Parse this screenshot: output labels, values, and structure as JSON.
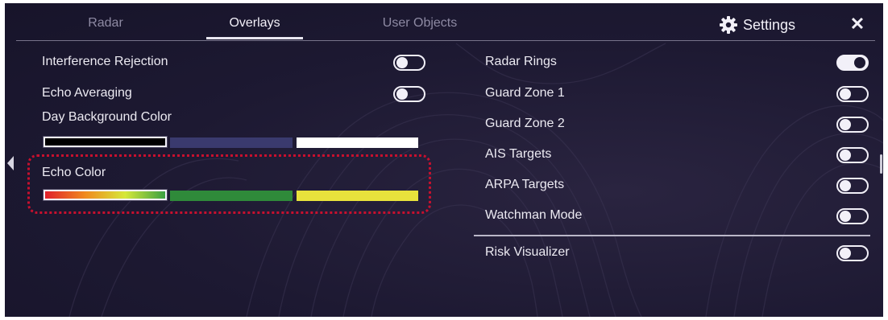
{
  "tabs": [
    {
      "label": "Radar",
      "active": false
    },
    {
      "label": "Overlays",
      "active": true
    },
    {
      "label": "User Objects",
      "active": false
    }
  ],
  "header": {
    "settings_label": "Settings",
    "close_glyph": "✕",
    "settings_icon": "gear-icon"
  },
  "left": {
    "interference_rejection": {
      "label": "Interference Rejection",
      "on": false
    },
    "echo_averaging": {
      "label": "Echo Averaging",
      "on": false
    },
    "day_background": {
      "label": "Day Background Color",
      "swatches": [
        "#000000",
        "#3a3a6e",
        "#ffffff"
      ],
      "selected": 0
    },
    "echo_color": {
      "label": "Echo Color",
      "swatches": [
        "multicolor",
        "#2f8a3a",
        "#e8e23c"
      ],
      "selected": 0
    }
  },
  "right": [
    {
      "label": "Radar Rings",
      "on": true
    },
    {
      "label": "Guard Zone 1",
      "on": false
    },
    {
      "label": "Guard Zone 2",
      "on": false
    },
    {
      "label": "AIS Targets",
      "on": false
    },
    {
      "label": "ARPA Targets",
      "on": false
    },
    {
      "label": "Watchman Mode",
      "on": false
    },
    {
      "label": "Risk Visualizer",
      "on": false
    }
  ],
  "colors": {
    "background": "#1d1932",
    "highlight": "#c8102e",
    "foreground": "#f2f0f8"
  }
}
